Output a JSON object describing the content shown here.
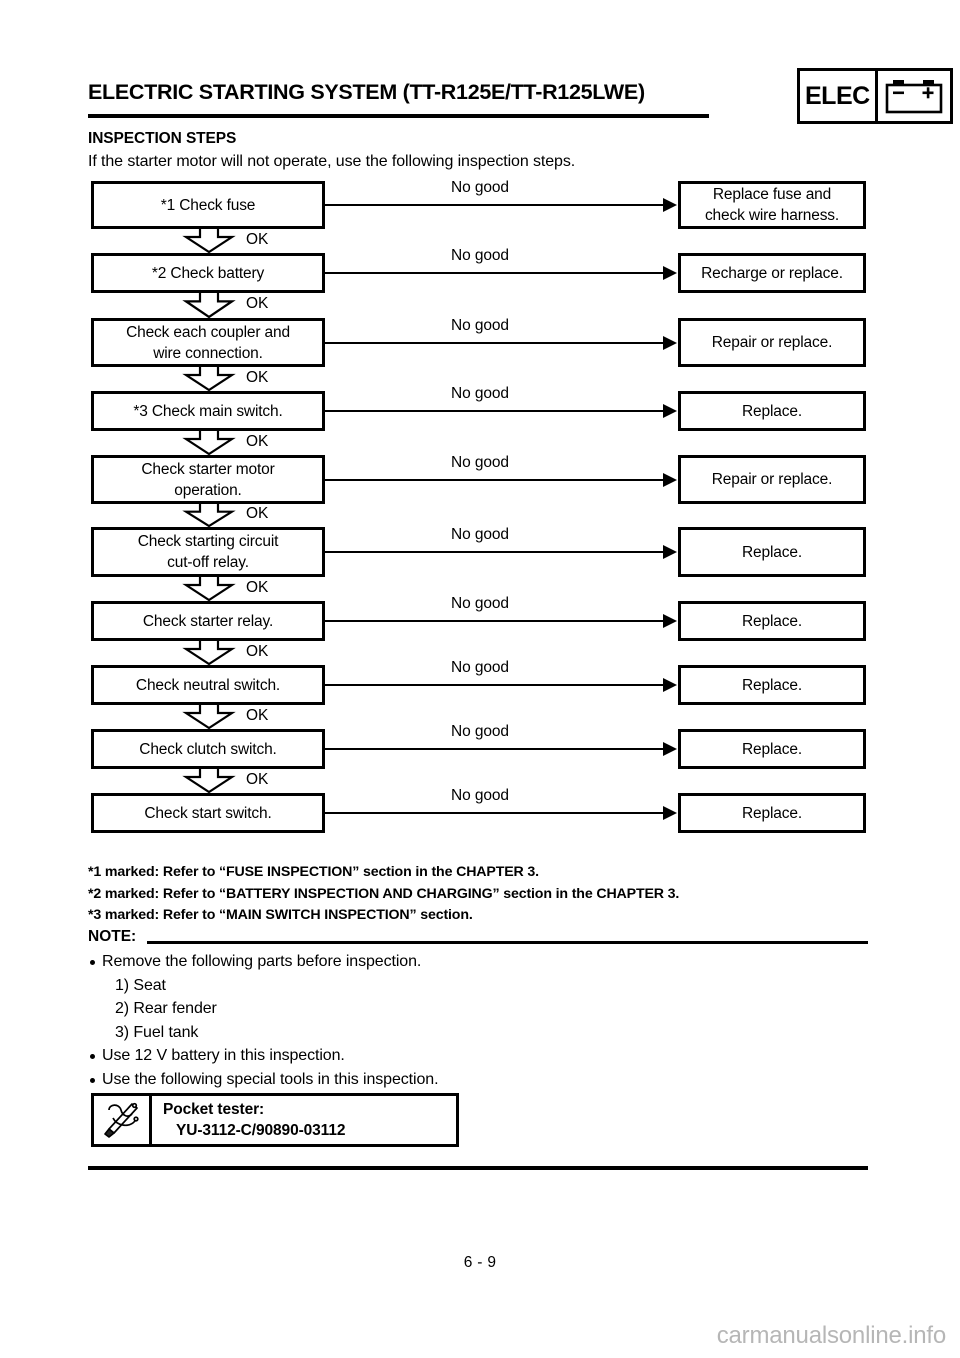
{
  "header": {
    "title": "ELECTRIC STARTING SYSTEM (TT-R125E/TT-R125LWE)",
    "badge_text": "ELEC",
    "badge_icon": "battery-icon"
  },
  "section": {
    "heading": "INSPECTION STEPS",
    "intro": "If the starter motor will not operate, use the following inspection steps."
  },
  "flowchart": {
    "ok_label": "OK",
    "nogood_label": "No good",
    "steps": [
      {
        "check": "*1 Check fuse",
        "action": "Replace fuse and\ncheck wire harness."
      },
      {
        "check": "*2 Check battery",
        "action": "Recharge or replace."
      },
      {
        "check": "Check each coupler and\nwire connection.",
        "action": "Repair or replace."
      },
      {
        "check": "*3 Check main switch.",
        "action": "Replace."
      },
      {
        "check": "Check starter motor\noperation.",
        "action": "Repair or replace."
      },
      {
        "check": "Check starting circuit\ncut-off relay.",
        "action": "Replace."
      },
      {
        "check": "Check starter relay.",
        "action": "Replace."
      },
      {
        "check": "Check neutral switch.",
        "action": "Replace."
      },
      {
        "check": "Check clutch switch.",
        "action": "Replace."
      },
      {
        "check": "Check start switch.",
        "action": "Replace."
      }
    ]
  },
  "footnotes": [
    "*1 marked: Refer to “FUSE INSPECTION” section in the CHAPTER 3.",
    "*2 marked: Refer to “BATTERY INSPECTION AND CHARGING” section in the CHAPTER 3.",
    "*3 marked: Refer to “MAIN SWITCH INSPECTION” section."
  ],
  "note": {
    "label": "NOTE:",
    "lines": [
      {
        "type": "bullet",
        "text": "Remove the following parts before inspection."
      },
      {
        "type": "number",
        "text": "1)  Seat"
      },
      {
        "type": "number",
        "text": "2)  Rear fender"
      },
      {
        "type": "number",
        "text": "3)  Fuel tank"
      },
      {
        "type": "bullet",
        "text": "Use 12 V battery in this inspection."
      },
      {
        "type": "bullet",
        "text": "Use the following special tools in this inspection."
      }
    ]
  },
  "tool": {
    "icon": "pocket-tester-tool-icon",
    "name": "Pocket tester:",
    "part_number": "YU-3112-C/90890-03112"
  },
  "footer": {
    "page_number": "6 - 9",
    "watermark": "carmanualsonline.info"
  },
  "colors": {
    "ink": "#000000",
    "paper": "#ffffff",
    "watermark": "#b6b6b6"
  }
}
